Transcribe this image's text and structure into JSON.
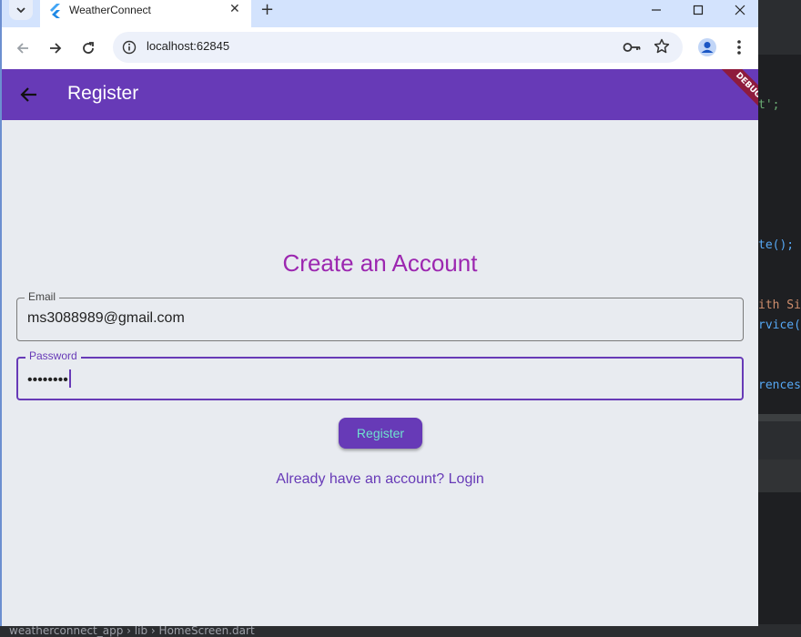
{
  "browser": {
    "tab_title": "WeatherConnect",
    "url": "localhost:62845"
  },
  "app": {
    "appbar_title": "Register",
    "debug_banner": "DEBUG",
    "heading": "Create an Account",
    "email": {
      "label": "Email",
      "value": "ms3088989@gmail.com"
    },
    "password": {
      "label": "Password",
      "value": "••••••••"
    },
    "register_button": "Register",
    "login_link": "Already have an account? Login",
    "colors": {
      "primary": "#673ab7",
      "heading": "#9c27b0",
      "button_text": "#6fe3cf"
    }
  },
  "ide": {
    "code_fragments": [
      "t';",
      "te();",
      "ith Si",
      "rvice(",
      "rences"
    ],
    "status_path": [
      "weatherconnect_app",
      "lib",
      "HomeScreen.dart"
    ]
  }
}
